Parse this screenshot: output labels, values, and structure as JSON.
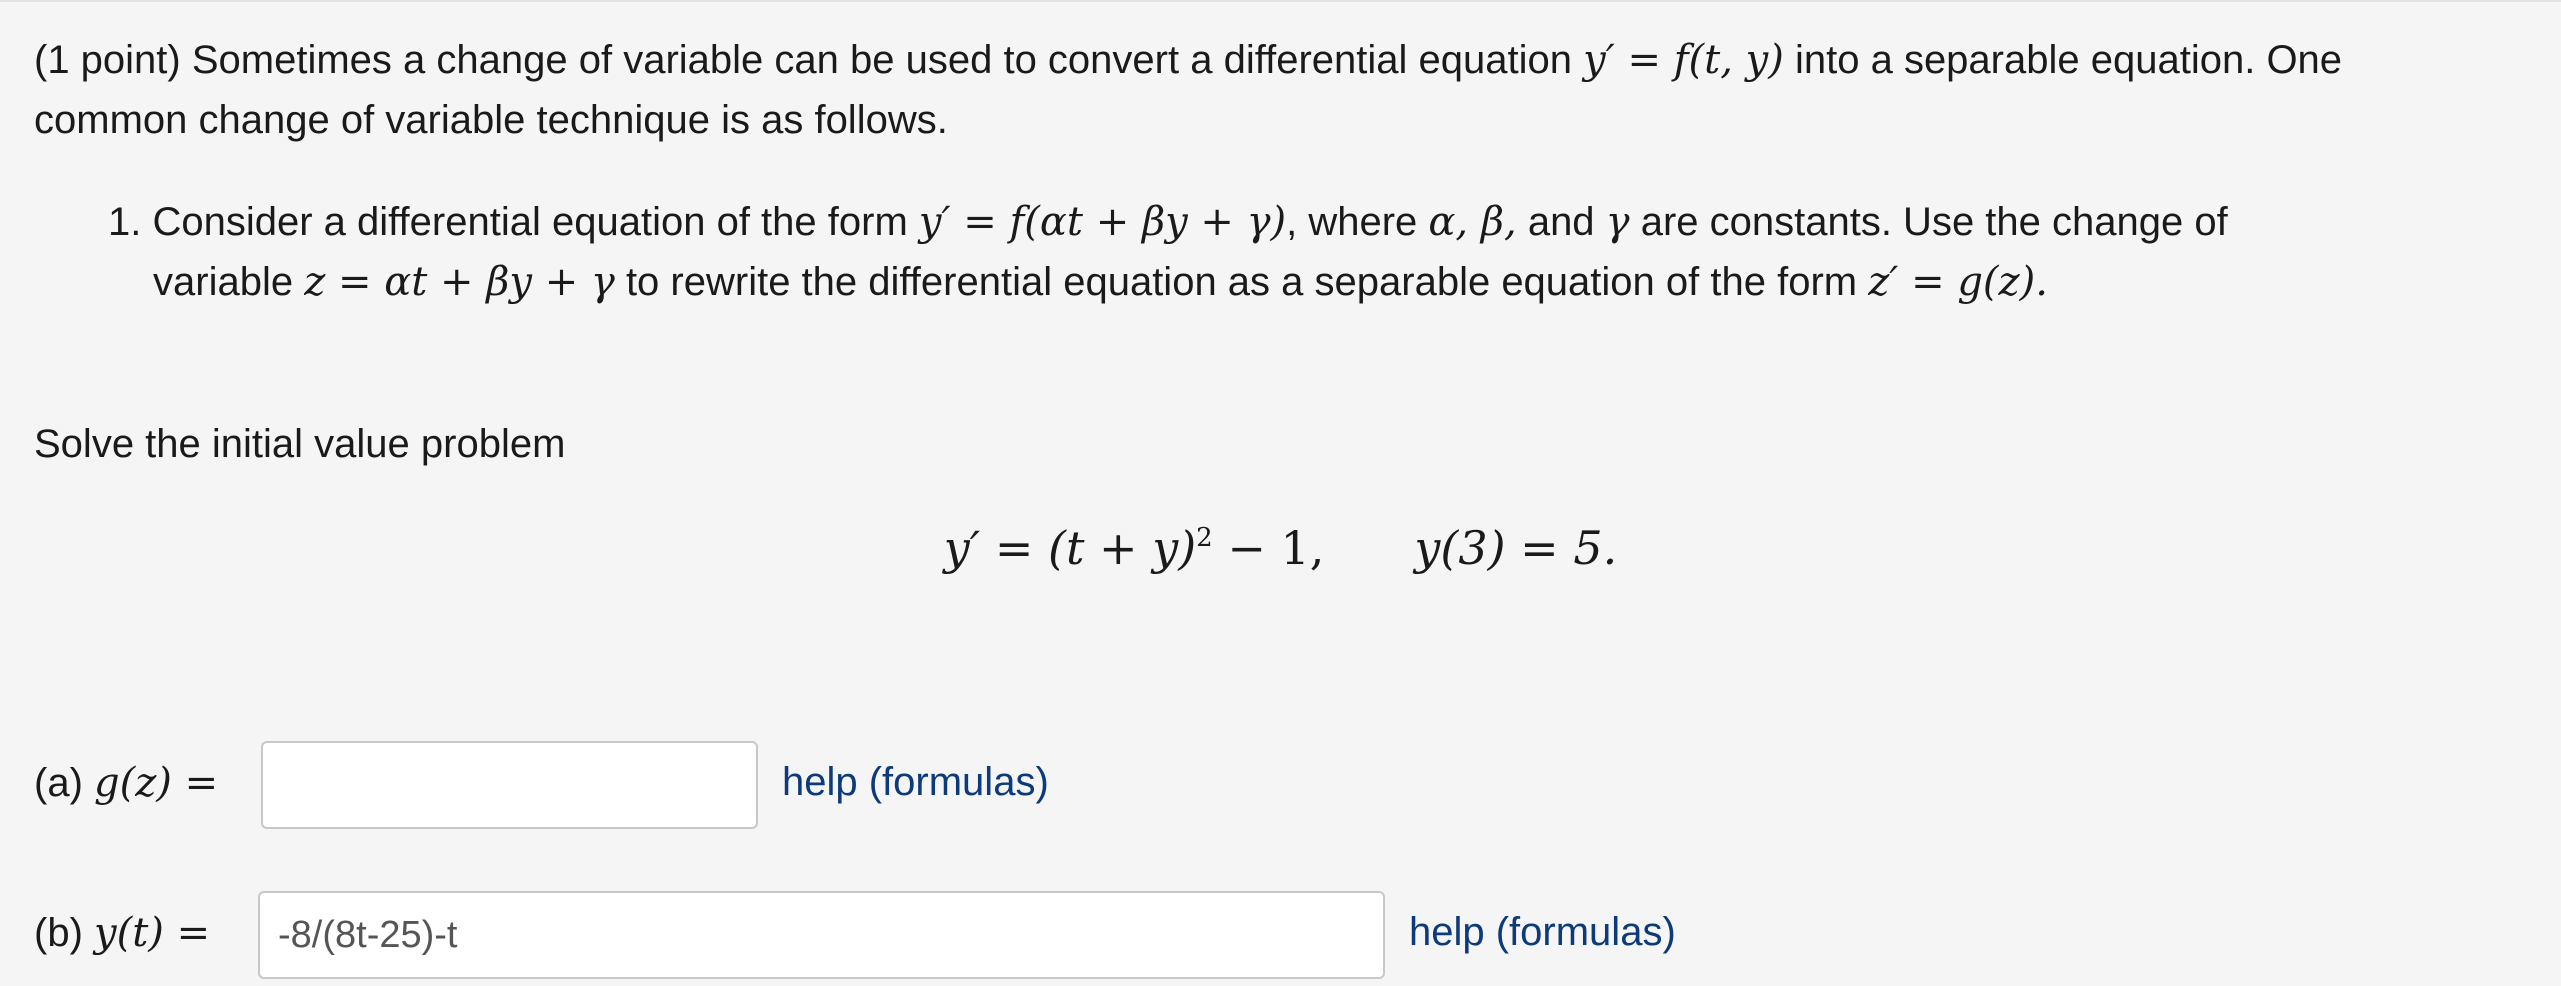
{
  "intro": {
    "prefix": "(1 point) Sometimes a change of variable can be used to convert a differential equation ",
    "math1": "y′ = f(t, y)",
    "suffix": " into a separable equation. One",
    "line2": "common change of variable technique is as follows."
  },
  "step1": {
    "number": "1.",
    "prefix": "Consider a differential equation of the form ",
    "math_form": "y′ = f(αt + βy + γ)",
    "mid": ", where ",
    "math_consts": "α, β,",
    "and_text": " and ",
    "math_gamma": "γ",
    "suffix": " are constants. Use the change of",
    "line2_prefix": "variable ",
    "math_sub": "z = αt + βy + γ",
    "line2_mid": " to rewrite the differential equation as a separable equation of the form ",
    "math_target": "z′ = g(z)."
  },
  "solve_text": "Solve the initial value problem",
  "ivp": {
    "equation": "y′ = (t + y)",
    "exponent": "2",
    "rest": " − 1,",
    "condition": "y(3) = 5."
  },
  "part_a": {
    "label_prefix": "(a) ",
    "label_math": "g(z) =",
    "value": "",
    "help": "help (formulas)"
  },
  "part_b": {
    "label_prefix": "(b) ",
    "label_math": "y(t) =",
    "value": "-8/(8t-25)-t",
    "help": "help (formulas)"
  }
}
